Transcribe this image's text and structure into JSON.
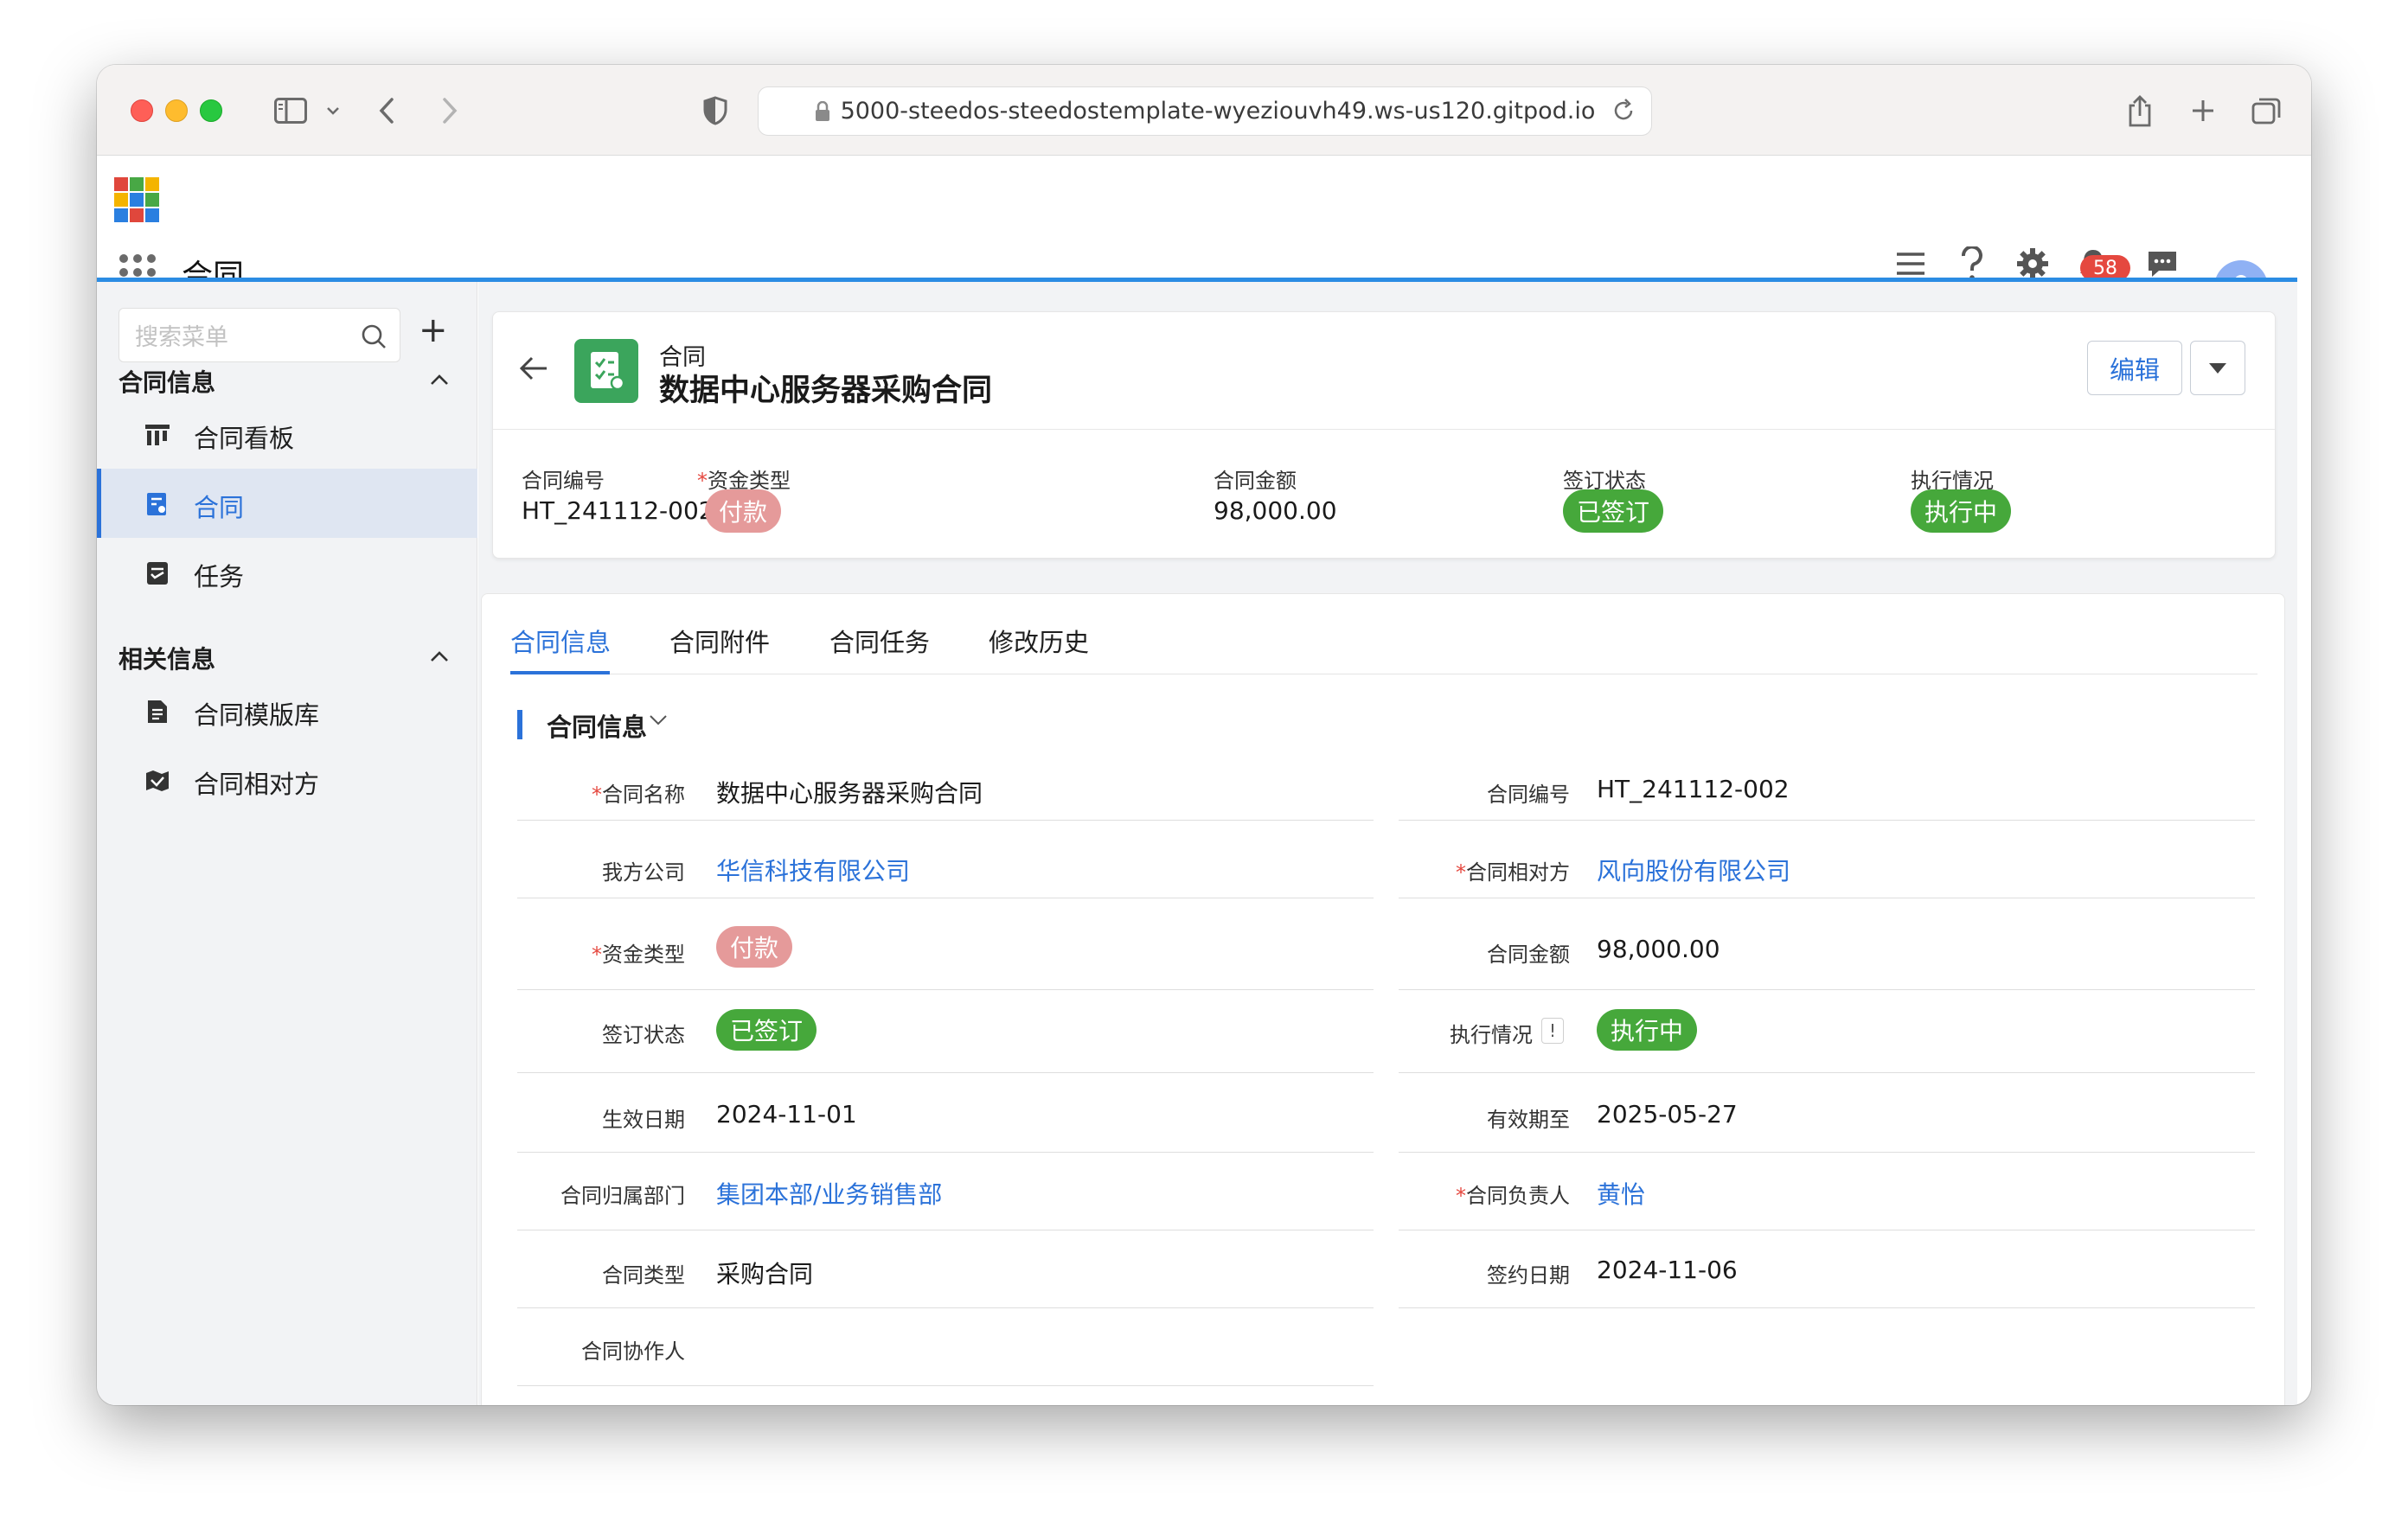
{
  "browser": {
    "url": "5000-steedos-steedostemplate-wyeziouvh49.ws-us120.gitpod.io"
  },
  "header": {
    "app_name": "合同",
    "notification_count": "58",
    "icons": [
      "menu-icon",
      "help-icon",
      "settings-icon",
      "bell-icon",
      "chat-icon",
      "avatar-icon"
    ]
  },
  "sidebar": {
    "search_placeholder": "搜索菜单",
    "add": "+",
    "groups": [
      {
        "title": "合同信息",
        "items": [
          {
            "label": "合同看板",
            "icon": "kanban-icon"
          },
          {
            "label": "合同",
            "icon": "contract-icon",
            "active": true
          },
          {
            "label": "任务",
            "icon": "task-icon"
          }
        ]
      },
      {
        "title": "相关信息",
        "items": [
          {
            "label": "合同模版库",
            "icon": "template-icon"
          },
          {
            "label": "合同相对方",
            "icon": "counterparty-icon"
          }
        ]
      }
    ]
  },
  "record": {
    "object_label": "合同",
    "title": "数据中心服务器采购合同",
    "edit_label": "编辑",
    "highlights": [
      {
        "label": "合同编号",
        "value": "HT_241112-002"
      },
      {
        "label": "资金类型",
        "value": "付款",
        "required": true
      },
      {
        "label": "合同金额",
        "value": "98,000.00"
      },
      {
        "label": "签订状态",
        "value": "已签订"
      },
      {
        "label": "执行情况",
        "value": "执行中"
      }
    ]
  },
  "tabs": [
    "合同信息",
    "合同附件",
    "合同任务",
    "修改历史"
  ],
  "section": {
    "title": "合同信息",
    "fields": {
      "name": {
        "label": "合同名称",
        "value": "数据中心服务器采购合同"
      },
      "code": {
        "label": "合同编号",
        "value": "HT_241112-002"
      },
      "our_company": {
        "label": "我方公司",
        "value": "华信科技有限公司"
      },
      "counterparty": {
        "label": "合同相对方",
        "value": "风向股份有限公司"
      },
      "fund_type": {
        "label": "资金类型",
        "value": "付款"
      },
      "amount": {
        "label": "合同金额",
        "value": "98,000.00"
      },
      "sign_status": {
        "label": "签订状态",
        "value": "已签订"
      },
      "exec_status": {
        "label": "执行情况",
        "value": "执行中"
      },
      "start_date": {
        "label": "生效日期",
        "value": "2024-11-01"
      },
      "end_date": {
        "label": "有效期至",
        "value": "2025-05-27"
      },
      "department": {
        "label": "合同归属部门",
        "value": "集团本部/业务销售部"
      },
      "owner": {
        "label": "合同负责人",
        "value": "黄怡"
      },
      "type": {
        "label": "合同类型",
        "value": "采购合同"
      },
      "sign_date": {
        "label": "签约日期",
        "value": "2024-11-06"
      },
      "collaborators": {
        "label": "合同协作人",
        "value": ""
      }
    }
  },
  "colors": {
    "accent": "#2b72d9",
    "pink_pill": "#e59a9a",
    "green_pill": "#46a83b",
    "badge": "#e5483f"
  }
}
